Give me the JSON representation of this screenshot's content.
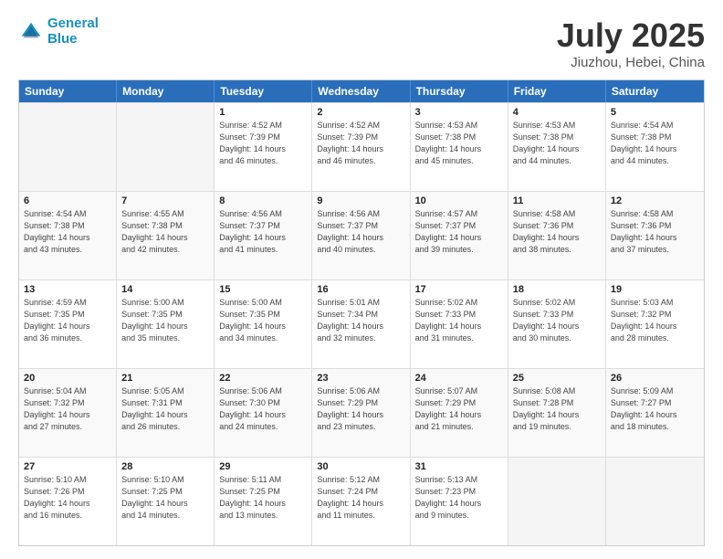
{
  "header": {
    "logo_line1": "General",
    "logo_line2": "Blue",
    "title": "July 2025",
    "subtitle": "Jiuzhou, Hebei, China"
  },
  "weekdays": [
    "Sunday",
    "Monday",
    "Tuesday",
    "Wednesday",
    "Thursday",
    "Friday",
    "Saturday"
  ],
  "rows": [
    [
      {
        "day": "",
        "info": "",
        "empty": true
      },
      {
        "day": "",
        "info": "",
        "empty": true
      },
      {
        "day": "1",
        "info": "Sunrise: 4:52 AM\nSunset: 7:39 PM\nDaylight: 14 hours\nand 46 minutes.",
        "empty": false
      },
      {
        "day": "2",
        "info": "Sunrise: 4:52 AM\nSunset: 7:39 PM\nDaylight: 14 hours\nand 46 minutes.",
        "empty": false
      },
      {
        "day": "3",
        "info": "Sunrise: 4:53 AM\nSunset: 7:38 PM\nDaylight: 14 hours\nand 45 minutes.",
        "empty": false
      },
      {
        "day": "4",
        "info": "Sunrise: 4:53 AM\nSunset: 7:38 PM\nDaylight: 14 hours\nand 44 minutes.",
        "empty": false
      },
      {
        "day": "5",
        "info": "Sunrise: 4:54 AM\nSunset: 7:38 PM\nDaylight: 14 hours\nand 44 minutes.",
        "empty": false
      }
    ],
    [
      {
        "day": "6",
        "info": "Sunrise: 4:54 AM\nSunset: 7:38 PM\nDaylight: 14 hours\nand 43 minutes.",
        "empty": false
      },
      {
        "day": "7",
        "info": "Sunrise: 4:55 AM\nSunset: 7:38 PM\nDaylight: 14 hours\nand 42 minutes.",
        "empty": false
      },
      {
        "day": "8",
        "info": "Sunrise: 4:56 AM\nSunset: 7:37 PM\nDaylight: 14 hours\nand 41 minutes.",
        "empty": false
      },
      {
        "day": "9",
        "info": "Sunrise: 4:56 AM\nSunset: 7:37 PM\nDaylight: 14 hours\nand 40 minutes.",
        "empty": false
      },
      {
        "day": "10",
        "info": "Sunrise: 4:57 AM\nSunset: 7:37 PM\nDaylight: 14 hours\nand 39 minutes.",
        "empty": false
      },
      {
        "day": "11",
        "info": "Sunrise: 4:58 AM\nSunset: 7:36 PM\nDaylight: 14 hours\nand 38 minutes.",
        "empty": false
      },
      {
        "day": "12",
        "info": "Sunrise: 4:58 AM\nSunset: 7:36 PM\nDaylight: 14 hours\nand 37 minutes.",
        "empty": false
      }
    ],
    [
      {
        "day": "13",
        "info": "Sunrise: 4:59 AM\nSunset: 7:35 PM\nDaylight: 14 hours\nand 36 minutes.",
        "empty": false
      },
      {
        "day": "14",
        "info": "Sunrise: 5:00 AM\nSunset: 7:35 PM\nDaylight: 14 hours\nand 35 minutes.",
        "empty": false
      },
      {
        "day": "15",
        "info": "Sunrise: 5:00 AM\nSunset: 7:35 PM\nDaylight: 14 hours\nand 34 minutes.",
        "empty": false
      },
      {
        "day": "16",
        "info": "Sunrise: 5:01 AM\nSunset: 7:34 PM\nDaylight: 14 hours\nand 32 minutes.",
        "empty": false
      },
      {
        "day": "17",
        "info": "Sunrise: 5:02 AM\nSunset: 7:33 PM\nDaylight: 14 hours\nand 31 minutes.",
        "empty": false
      },
      {
        "day": "18",
        "info": "Sunrise: 5:02 AM\nSunset: 7:33 PM\nDaylight: 14 hours\nand 30 minutes.",
        "empty": false
      },
      {
        "day": "19",
        "info": "Sunrise: 5:03 AM\nSunset: 7:32 PM\nDaylight: 14 hours\nand 28 minutes.",
        "empty": false
      }
    ],
    [
      {
        "day": "20",
        "info": "Sunrise: 5:04 AM\nSunset: 7:32 PM\nDaylight: 14 hours\nand 27 minutes.",
        "empty": false
      },
      {
        "day": "21",
        "info": "Sunrise: 5:05 AM\nSunset: 7:31 PM\nDaylight: 14 hours\nand 26 minutes.",
        "empty": false
      },
      {
        "day": "22",
        "info": "Sunrise: 5:06 AM\nSunset: 7:30 PM\nDaylight: 14 hours\nand 24 minutes.",
        "empty": false
      },
      {
        "day": "23",
        "info": "Sunrise: 5:06 AM\nSunset: 7:29 PM\nDaylight: 14 hours\nand 23 minutes.",
        "empty": false
      },
      {
        "day": "24",
        "info": "Sunrise: 5:07 AM\nSunset: 7:29 PM\nDaylight: 14 hours\nand 21 minutes.",
        "empty": false
      },
      {
        "day": "25",
        "info": "Sunrise: 5:08 AM\nSunset: 7:28 PM\nDaylight: 14 hours\nand 19 minutes.",
        "empty": false
      },
      {
        "day": "26",
        "info": "Sunrise: 5:09 AM\nSunset: 7:27 PM\nDaylight: 14 hours\nand 18 minutes.",
        "empty": false
      }
    ],
    [
      {
        "day": "27",
        "info": "Sunrise: 5:10 AM\nSunset: 7:26 PM\nDaylight: 14 hours\nand 16 minutes.",
        "empty": false
      },
      {
        "day": "28",
        "info": "Sunrise: 5:10 AM\nSunset: 7:25 PM\nDaylight: 14 hours\nand 14 minutes.",
        "empty": false
      },
      {
        "day": "29",
        "info": "Sunrise: 5:11 AM\nSunset: 7:25 PM\nDaylight: 14 hours\nand 13 minutes.",
        "empty": false
      },
      {
        "day": "30",
        "info": "Sunrise: 5:12 AM\nSunset: 7:24 PM\nDaylight: 14 hours\nand 11 minutes.",
        "empty": false
      },
      {
        "day": "31",
        "info": "Sunrise: 5:13 AM\nSunset: 7:23 PM\nDaylight: 14 hours\nand 9 minutes.",
        "empty": false
      },
      {
        "day": "",
        "info": "",
        "empty": true
      },
      {
        "day": "",
        "info": "",
        "empty": true
      }
    ]
  ]
}
